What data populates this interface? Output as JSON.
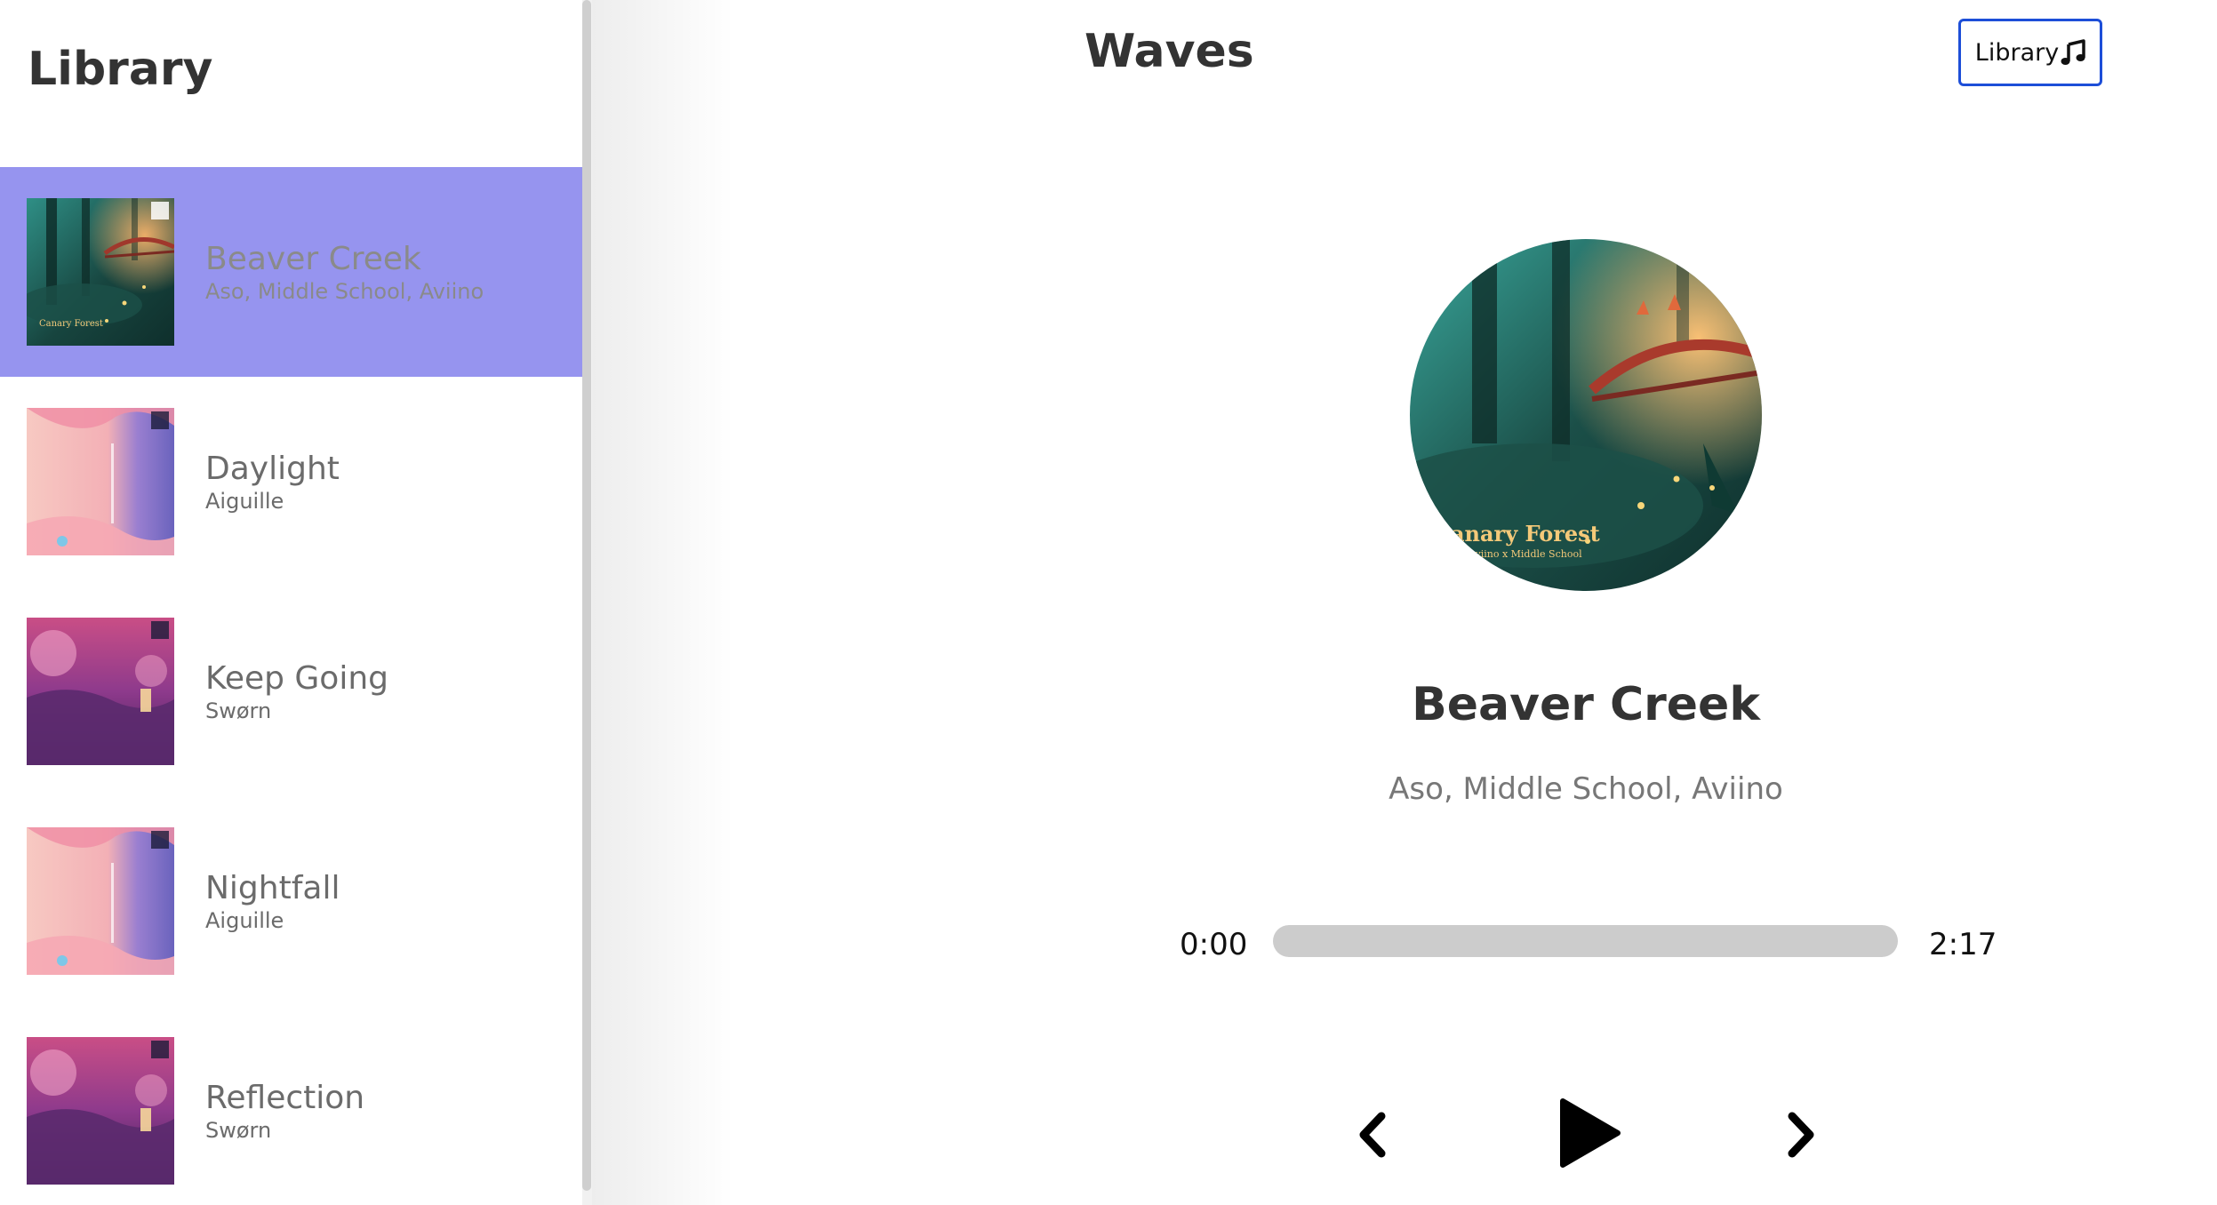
{
  "library": {
    "title": "Library",
    "songs": [
      {
        "name": "Beaver Creek",
        "artist": "Aso, Middle School, Aviino",
        "selected": true,
        "cover_text": "Canary Forest"
      },
      {
        "name": "Daylight",
        "artist": "Aiguille",
        "selected": false
      },
      {
        "name": "Keep Going",
        "artist": "Swørn",
        "selected": false
      },
      {
        "name": "Nightfall",
        "artist": "Aiguille",
        "selected": false
      },
      {
        "name": "Reflection",
        "artist": "Swørn",
        "selected": false
      }
    ]
  },
  "header": {
    "title": "Waves",
    "library_button_label": "Library",
    "library_button_icon": "music-note-icon"
  },
  "player": {
    "cover_text": "anary Forest",
    "cover_subtext": "Aviino x Middle School",
    "title": "Beaver Creek",
    "artist": "Aso, Middle School, Aviino",
    "current_time": "0:00",
    "total_time": "2:17",
    "progress_fraction": 0,
    "controls": {
      "prev_icon": "chevron-left-icon",
      "play_icon": "play-icon",
      "next_icon": "chevron-right-icon"
    }
  },
  "colors": {
    "selected_background": "#9694ef",
    "accent_border": "#1d4ed8",
    "progress_track": "#cccccc"
  }
}
